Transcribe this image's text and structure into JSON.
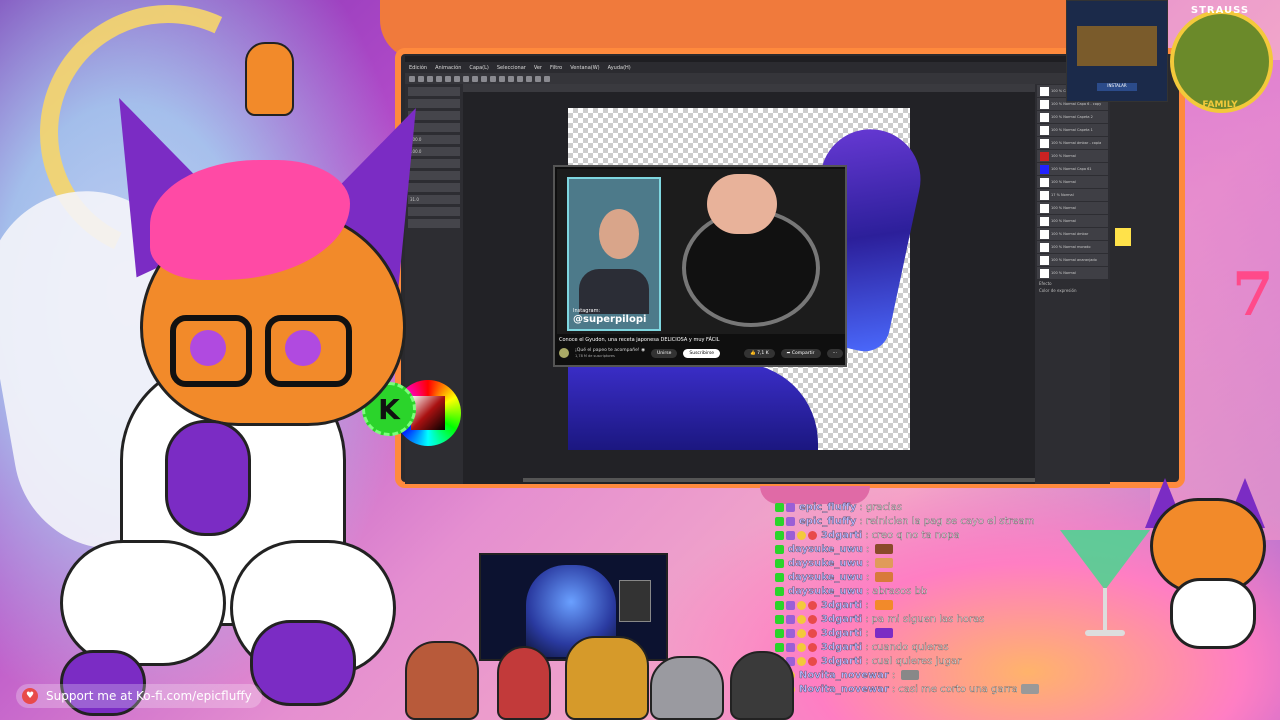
{
  "app": {
    "menu": [
      "Edición",
      "Animación",
      "Capa(L)",
      "Seleccionar",
      "Ver",
      "Filtro",
      "Ventana(W)",
      "Ayuda(H)"
    ],
    "left_panel_rows": [
      "200.0",
      "100.0",
      "",
      "",
      "",
      "31.0",
      "",
      ""
    ],
    "layers": [
      "100 % Color Capa 60",
      "100 % Normal Capa 6 - copy",
      "100 % Normal Capeta 2",
      "100 % Normal Capeta 1",
      "100 % Normal ámbar - copia",
      "100 % Normal",
      "100 % Normal Capa 61",
      "100 % Normal",
      "17 % Normal",
      "100 % Normal",
      "100 % Normal",
      "100 % Normal ámbar",
      "100 % Normal morado",
      "100 % Normal anaranjado",
      "100 % Normal"
    ],
    "right_panel_labels": [
      "Efecto",
      "Color de expresión"
    ]
  },
  "youtube": {
    "handle": "@superpilopi",
    "handle_label": "Instagram:",
    "title": "Conoce el Gyudon, una receta japonesa DELICIOSA y muy FÁCIL",
    "channel": "¡Qué el papeo te acompañe! ◉",
    "subs": "1,78 M de suscriptores",
    "join": "Unirse",
    "subscribe": "Suscribirse",
    "likes": "7,1 K",
    "share": "Compartir"
  },
  "kbadge": "K",
  "logo": {
    "top": "STRAUSS",
    "bottom": "FAMILY"
  },
  "gamebox_btn": "INSTALAR",
  "seven": "7",
  "chat": [
    {
      "user": "epic_fluffy",
      "msg": "gracias",
      "badges": [
        "k",
        "pur"
      ],
      "emote": ""
    },
    {
      "user": "epic_fluffy",
      "msg": "reinicien la pag se cayo el stream",
      "badges": [
        "k",
        "pur"
      ],
      "emote": ""
    },
    {
      "user": "3dgarti",
      "msg": "creo q no ta nopa",
      "badges": [
        "k",
        "pur",
        "y",
        "r"
      ],
      "emote": ""
    },
    {
      "user": "daysuke_uwu",
      "msg": "",
      "badges": [
        "k"
      ],
      "emote": "#8a4a2a"
    },
    {
      "user": "daysuke_uwu",
      "msg": "",
      "badges": [
        "k"
      ],
      "emote": "#e09b5a"
    },
    {
      "user": "daysuke_uwu",
      "msg": "",
      "badges": [
        "k"
      ],
      "emote": "#d87a3a"
    },
    {
      "user": "daysuke_uwu",
      "msg": "abrasos bb",
      "badges": [
        "k"
      ],
      "emote": ""
    },
    {
      "user": "3dgarti",
      "msg": "",
      "badges": [
        "k",
        "pur",
        "y",
        "r"
      ],
      "emote": "#f28a2a"
    },
    {
      "user": "3dgarti",
      "msg": "pa mi siguen las horas",
      "badges": [
        "k",
        "pur",
        "y",
        "r"
      ],
      "emote": ""
    },
    {
      "user": "3dgarti",
      "msg": "",
      "badges": [
        "k",
        "pur",
        "y",
        "r"
      ],
      "emote": "#7b2cc4"
    },
    {
      "user": "3dgarti",
      "msg": "cuando quieras",
      "badges": [
        "k",
        "pur",
        "y",
        "r"
      ],
      "emote": ""
    },
    {
      "user": "3dgarti",
      "msg": "cual quieres jugar",
      "badges": [
        "k",
        "pur",
        "y",
        "r"
      ],
      "emote": ""
    },
    {
      "user": "Novita_novewar",
      "msg": "",
      "badges": [
        "k",
        "y"
      ],
      "emote": "#888"
    },
    {
      "user": "Novita_novewar",
      "msg": "casi me corto una garra",
      "badges": [
        "k",
        "y"
      ],
      "emote": "#999"
    }
  ],
  "kofi": {
    "text": "Support me at Ko-fi.com/epicfluffy"
  },
  "colors": {
    "accent_orange": "#f07a3c",
    "fox_purple": "#7b2cc4",
    "fox_pink": "#ff4aa5",
    "k_green": "#2bd42b"
  }
}
